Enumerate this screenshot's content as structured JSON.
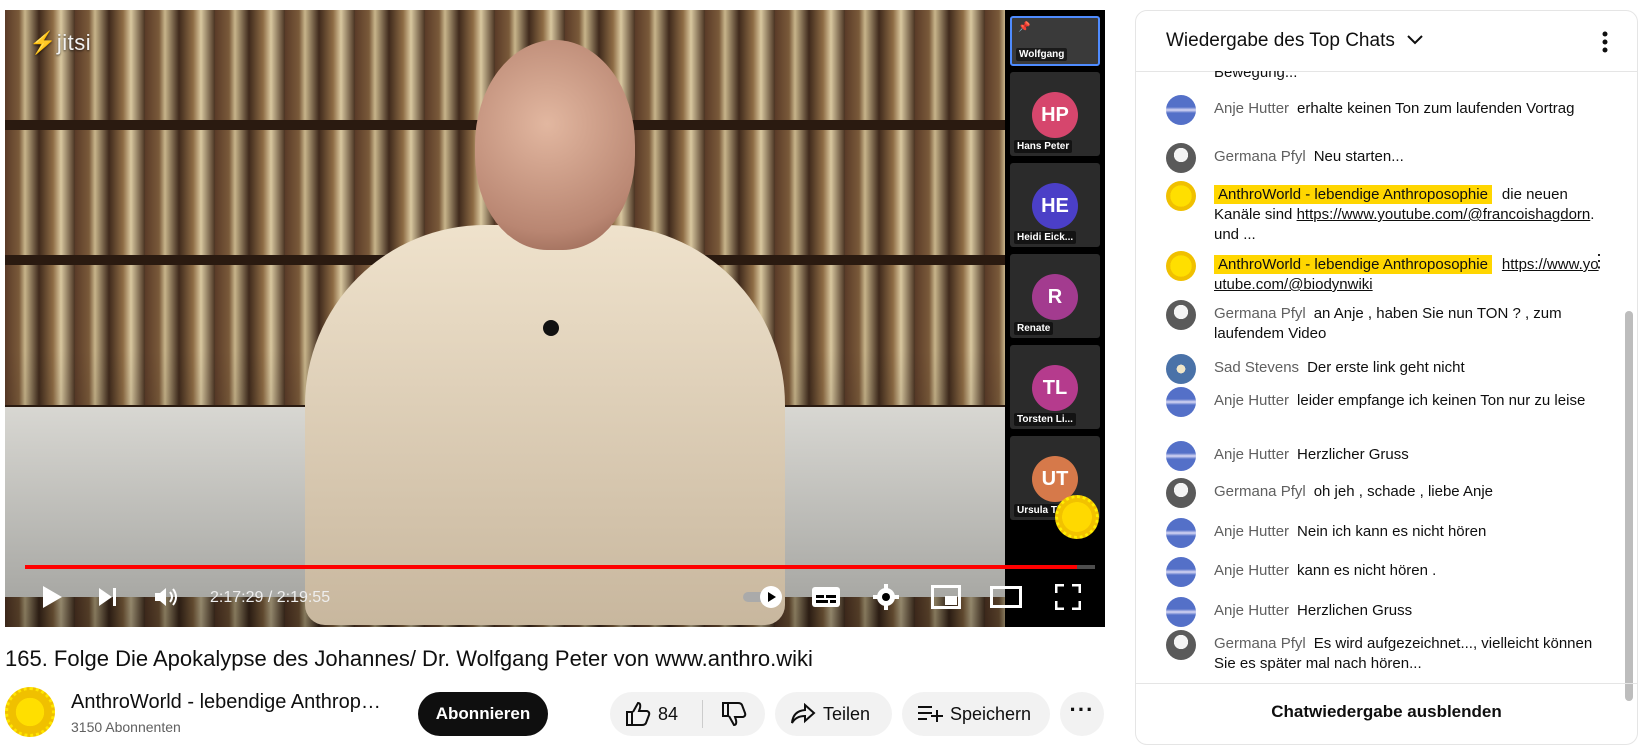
{
  "video": {
    "jitsi_logo": "jitsi",
    "time_display": "2:17:29 / 2:19:55",
    "progress": 0.983,
    "participants": [
      {
        "initials": "",
        "name": "Wolfgang",
        "color": "#3a3a3a",
        "selected": true
      },
      {
        "initials": "HP",
        "name": "Hans Peter",
        "color": "#d6466d"
      },
      {
        "initials": "HE",
        "name": "Heidi Eick...",
        "color": "#4b3fc7"
      },
      {
        "initials": "R",
        "name": "Renate",
        "color": "#a33b8f"
      },
      {
        "initials": "TL",
        "name": "Torsten Li...",
        "color": "#b53b8d"
      },
      {
        "initials": "UT",
        "name": "Ursula Th...",
        "color": "#d6794a"
      }
    ]
  },
  "video_title": "165. Folge Die Apokalypse des Johannes/ Dr. Wolfgang Peter von www.anthro.wiki",
  "channel": {
    "name": "AnthroWorld - lebendige Anthroposophie",
    "subscribers": "3150 Abonnenten",
    "subscribe_label": "Abonnieren"
  },
  "actions": {
    "like_count": "84",
    "share_label": "Teilen",
    "save_label": "Speichern"
  },
  "chat": {
    "title": "Wiedergabe des Top Chats",
    "hide_label": "Chatwiedergabe ausblenden",
    "truncated_top": "Bewegung...",
    "messages": [
      {
        "author": "Anje Hutter",
        "text": "erhalte keinen Ton zum laufenden Vortrag",
        "avatar": "anje"
      },
      {
        "author": "Germana Pfyl",
        "text": "Neu starten...",
        "avatar": "germana"
      },
      {
        "author": "AnthroWorld - lebendige Anthroposophie",
        "text": "die neuen Kanäle sind ",
        "link": "https://www.youtube.com/@francoishagdorn",
        "after": ". und ...",
        "avatar": "owner",
        "owner": true
      },
      {
        "author": "AnthroWorld - lebendige Anthroposophie",
        "text": "",
        "link": "https://www.youtube.com/@biodynwiki",
        "after": "",
        "avatar": "owner",
        "owner": true
      },
      {
        "author": "Germana Pfyl",
        "text": "an Anje , haben Sie nun TON ? , zum laufendem Video",
        "avatar": "germana"
      },
      {
        "author": "Sad Stevens",
        "text": "Der erste link geht nicht",
        "avatar": "sad"
      },
      {
        "author": "Anje Hutter",
        "text": "leider empfange ich keinen Ton nur zu leise",
        "avatar": "anje"
      },
      {
        "author": "Anje Hutter",
        "text": "Herzlicher Gruss",
        "avatar": "anje"
      },
      {
        "author": "Germana Pfyl",
        "text": "oh jeh , schade , liebe Anje",
        "avatar": "germana"
      },
      {
        "author": "Anje Hutter",
        "text": "Nein ich kann es nicht hören",
        "avatar": "anje"
      },
      {
        "author": "Anje Hutter",
        "text": "kann es nicht hören .",
        "avatar": "anje"
      },
      {
        "author": "Anje Hutter",
        "text": "Herzlichen Gruss",
        "avatar": "anje"
      },
      {
        "author": "Germana Pfyl",
        "text": "Es wird aufgezeichnet..., vielleicht können Sie es später mal nach hören...",
        "avatar": "germana"
      }
    ]
  },
  "colors": {
    "progress_red": "#ff0000",
    "owner_highlight": "#ffd600",
    "subscribe_bg": "#0f0f0f"
  },
  "icons": [
    "play-icon",
    "next-icon",
    "volume-icon",
    "autoplay-toggle-icon",
    "subtitles-icon",
    "settings-icon",
    "miniplayer-icon",
    "theater-icon",
    "fullscreen-icon",
    "thumbs-up-icon",
    "thumbs-down-icon",
    "share-icon",
    "save-playlist-icon",
    "more-icon",
    "chevron-down-icon",
    "kebab-icon"
  ]
}
